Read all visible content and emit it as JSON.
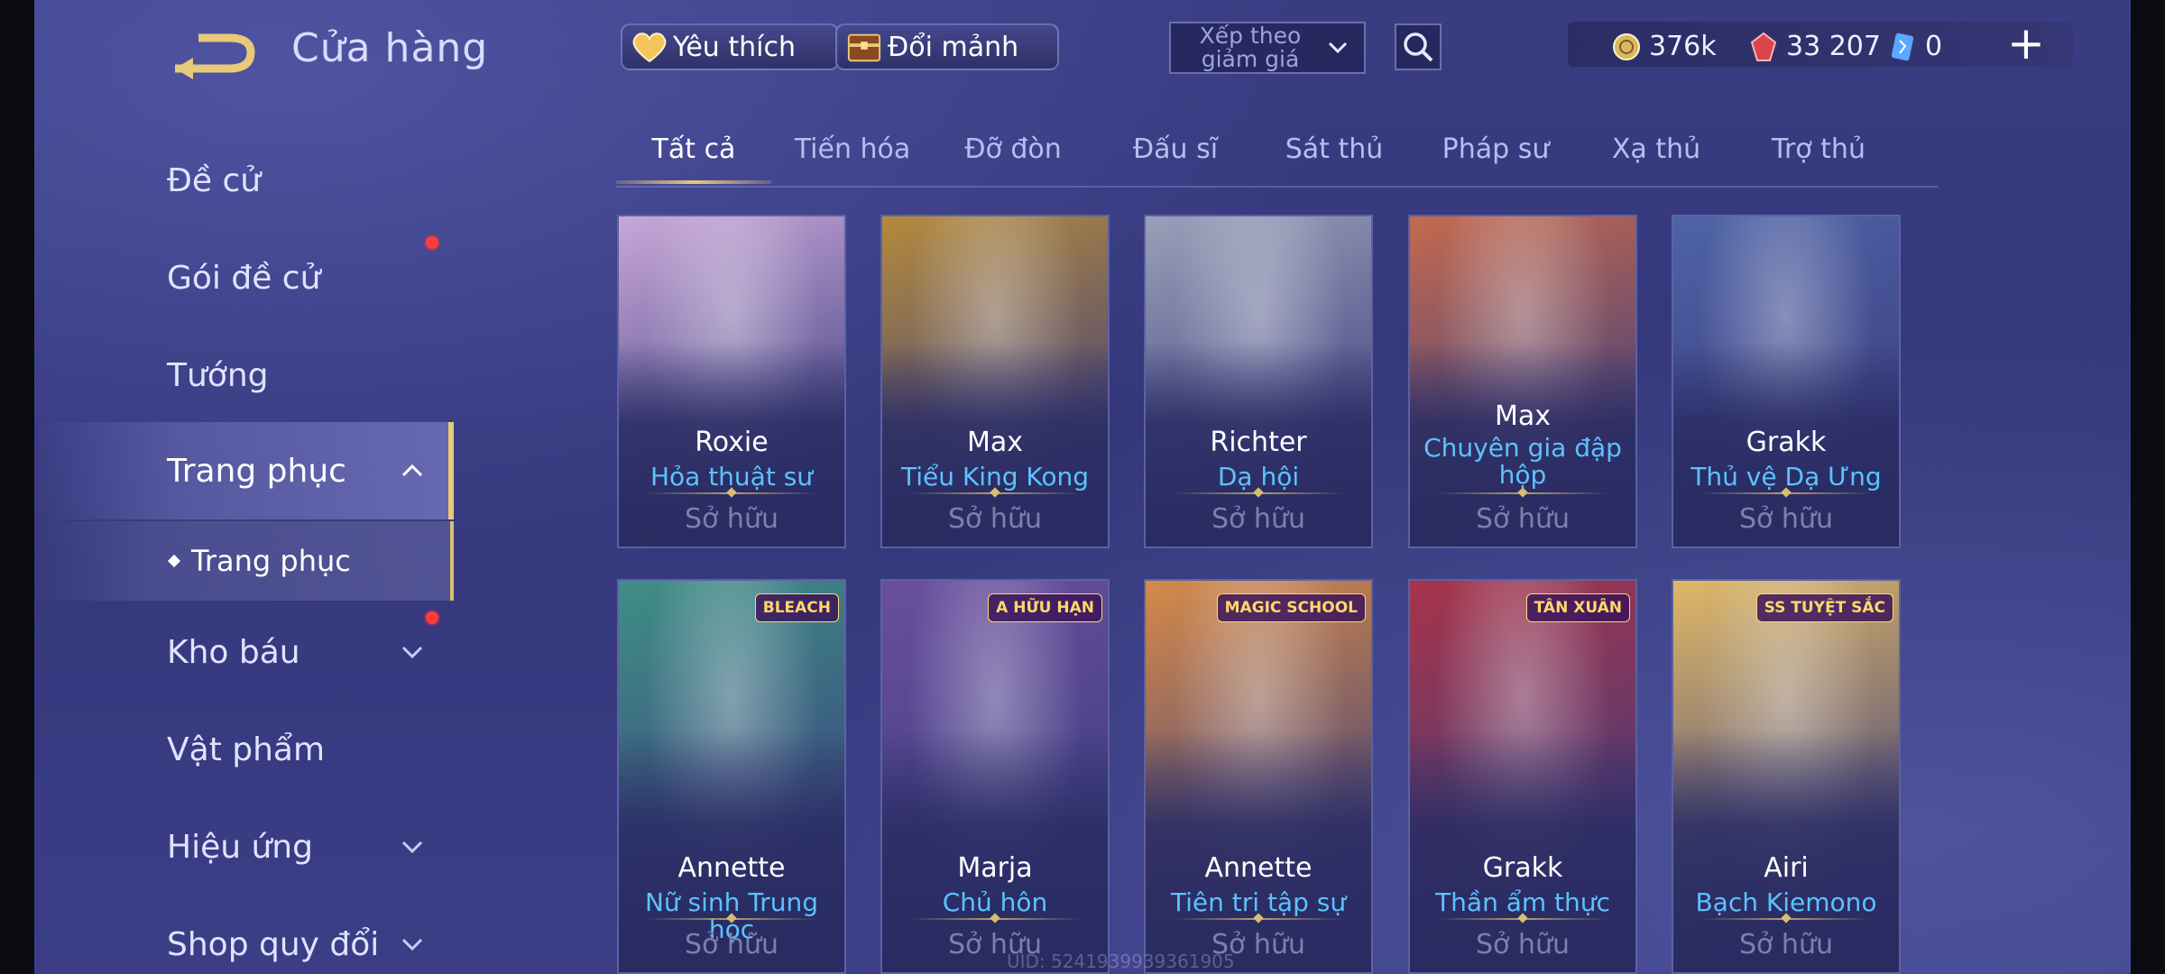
{
  "header": {
    "title": "Cửa hàng",
    "favorite_label": "Yêu thích",
    "exchange_label": "Đổi mảnh",
    "sort_label": "Xếp theo giảm giá",
    "currencies": [
      {
        "icon": "gold-coin-icon",
        "value": "376k"
      },
      {
        "icon": "red-gem-icon",
        "value": "33 207"
      },
      {
        "icon": "voucher-icon",
        "value": "0"
      }
    ],
    "plus_label": "+"
  },
  "sidebar": {
    "items": [
      {
        "label": "Đề cử"
      },
      {
        "label": "Gói đề cử"
      },
      {
        "label": "Tướng"
      },
      {
        "label": "Trang phục"
      },
      {
        "label": "Kho báu"
      },
      {
        "label": "Vật phẩm"
      },
      {
        "label": "Hiệu ứng"
      },
      {
        "label": "Shop quy đổi"
      }
    ],
    "sub_item": "Trang phục"
  },
  "tabs": [
    "Tất cả",
    "Tiến hóa",
    "Đỡ đòn",
    "Đấu sĩ",
    "Sát thủ",
    "Pháp sư",
    "Xạ thủ",
    "Trợ thủ"
  ],
  "cards": [
    {
      "hero": "Roxie",
      "skin": "Hỏa thuật sư",
      "status": "Sở hữu",
      "art_color": "#c9a7d8"
    },
    {
      "hero": "Max",
      "skin": "Tiểu King Kong",
      "status": "Sở hữu",
      "art_color": "#b58a3c"
    },
    {
      "hero": "Richter",
      "skin": "Dạ hội",
      "status": "Sở hữu",
      "art_color": "#9aa0b8"
    },
    {
      "hero": "Max",
      "skin": "Chuyên gia đập hộp",
      "status": "Sở hữu",
      "art_color": "#c46a4e"
    },
    {
      "hero": "Grakk",
      "skin": "Thủ vệ Dạ Ưng",
      "status": "Sở hữu",
      "art_color": "#4e63a6"
    },
    {
      "hero": "Annette",
      "skin": "Nữ sinh Trung học",
      "status": "Sở hữu",
      "art_color": "#3f8f86",
      "badge": "BLEACH"
    },
    {
      "hero": "Marja",
      "skin": "Chủ hôn",
      "status": "Sở hữu",
      "art_color": "#6a4f9e",
      "badge": "A HỮU HẠN"
    },
    {
      "hero": "Annette",
      "skin": "Tiên tri tập sự",
      "status": "Sở hữu",
      "art_color": "#d68a48",
      "badge": "MAGIC SCHOOL"
    },
    {
      "hero": "Grakk",
      "skin": "Thần ẩm thực",
      "status": "Sở hữu",
      "art_color": "#a8344a",
      "badge": "TÂN XUÂN"
    },
    {
      "hero": "Airi",
      "skin": "Bạch Kiemono",
      "status": "Sở hữu",
      "art_color": "#e0b866",
      "badge": "SS TUYỆT SẮC"
    }
  ],
  "uid_text": "UID: 5241939939361905",
  "colors": {
    "accent_gold": "#e7c979",
    "skin_name": "#5cc2ff",
    "status": "#7b80ad",
    "notify": "#ff3b3b"
  }
}
